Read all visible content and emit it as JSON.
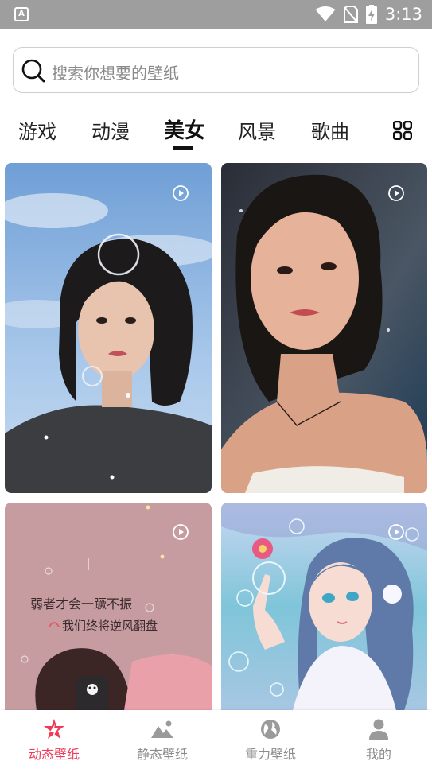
{
  "status_bar": {
    "time": "3:13",
    "notification_icon": "a-letter-icon",
    "icons": [
      "wifi-icon",
      "no-sim-icon",
      "battery-charging-icon"
    ]
  },
  "search": {
    "placeholder": "搜索你想要的壁纸",
    "icon": "search-icon"
  },
  "categories": {
    "tabs": [
      "游戏",
      "动漫",
      "美女",
      "风景",
      "歌曲"
    ],
    "active": "美女",
    "more_icon": "grid-icon"
  },
  "wallpapers": [
    {
      "kind": "dynamic",
      "subject": "girl under blue sky",
      "play_icon": "play-icon"
    },
    {
      "kind": "dynamic",
      "subject": "girl in dark room",
      "play_icon": "play-icon"
    },
    {
      "kind": "dynamic",
      "subject": "cartoon girl on pink background",
      "play_icon": "play-icon",
      "overlay_lines": [
        "弱者才会一蹶不振",
        "我们终将逆风翻盘"
      ]
    },
    {
      "kind": "dynamic",
      "subject": "anime girl with bubbles",
      "play_icon": "play-icon"
    }
  ],
  "bottom_nav": {
    "items": [
      {
        "label": "动态壁纸",
        "icon": "lightning-star-icon"
      },
      {
        "label": "静态壁纸",
        "icon": "mountain-image-icon"
      },
      {
        "label": "重力壁纸",
        "icon": "globe-icon"
      },
      {
        "label": "我的",
        "icon": "person-icon"
      }
    ],
    "active": "动态壁纸"
  },
  "colors": {
    "accent": "#ef3a59",
    "status_bar": "#9e9e9e",
    "inactive_nav": "#8c8c8c"
  }
}
